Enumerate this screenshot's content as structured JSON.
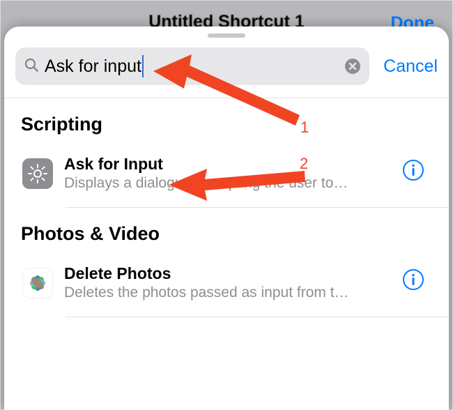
{
  "behind": {
    "title": "Untitled Shortcut 1",
    "done_label": "Done"
  },
  "search": {
    "value": "Ask for input",
    "cancel_label": "Cancel"
  },
  "sections": [
    {
      "header": "Scripting",
      "rows": [
        {
          "icon": "settings-gear-icon",
          "title": "Ask for Input",
          "subtitle": "Displays a dialogue prompting the user to…"
        }
      ]
    },
    {
      "header": "Photos & Video",
      "rows": [
        {
          "icon": "photos-app-icon",
          "title": "Delete Photos",
          "subtitle": "Deletes the photos passed as input from t…"
        }
      ]
    }
  ],
  "annotations": {
    "label1": "1",
    "label2": "2",
    "color": "#f04423"
  }
}
